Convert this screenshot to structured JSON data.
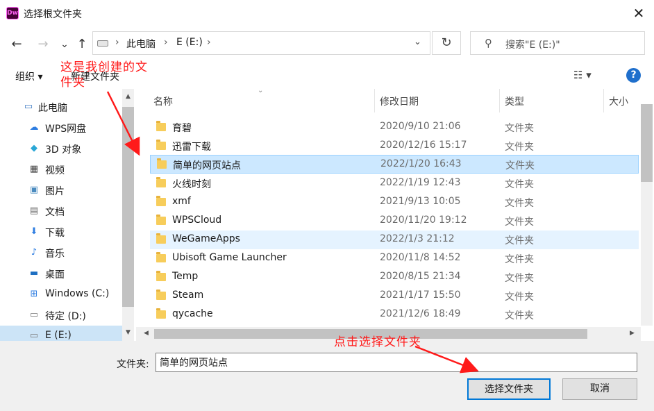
{
  "window": {
    "app_icon_text": "Dw",
    "title": "选择根文件夹",
    "close_glyph": "✕"
  },
  "nav": {
    "back_glyph": "←",
    "forward_glyph": "→",
    "recent_glyph": "⌄",
    "up_glyph": "↑",
    "breadcrumb": [
      "此电脑",
      "E (E:)"
    ],
    "separator": "›",
    "dropdown_glyph": "⌄",
    "refresh_glyph": "↻",
    "search_placeholder": "搜索\"E (E:)\""
  },
  "toolbar": {
    "organize_label": "组织 ▾",
    "new_folder_label": "新建文件夹",
    "view_glyph": "☷ ▾",
    "help_glyph": "?"
  },
  "sidebar": {
    "items": [
      {
        "label": "此电脑",
        "icon": "computer-icon"
      },
      {
        "label": "WPS网盘",
        "icon": "cloud-icon"
      },
      {
        "label": "3D 对象",
        "icon": "cube-icon"
      },
      {
        "label": "视频",
        "icon": "film-icon"
      },
      {
        "label": "图片",
        "icon": "picture-icon"
      },
      {
        "label": "文档",
        "icon": "document-icon"
      },
      {
        "label": "下载",
        "icon": "download-icon"
      },
      {
        "label": "音乐",
        "icon": "music-icon"
      },
      {
        "label": "桌面",
        "icon": "desktop-icon"
      },
      {
        "label": "Windows (C:)",
        "icon": "drive-c-icon"
      },
      {
        "label": "待定 (D:)",
        "icon": "drive-icon"
      },
      {
        "label": "E (E:)",
        "icon": "drive-icon"
      }
    ]
  },
  "filelist": {
    "columns": [
      "名称",
      "修改日期",
      "类型",
      "大小"
    ],
    "rows": [
      {
        "name": "育碧",
        "date": "2020/9/10 21:06",
        "type": "文件夹"
      },
      {
        "name": "迅雷下载",
        "date": "2020/12/16 15:17",
        "type": "文件夹"
      },
      {
        "name": "简单的网页站点",
        "date": "2022/1/20 16:43",
        "type": "文件夹"
      },
      {
        "name": "火线时刻",
        "date": "2022/1/19 12:43",
        "type": "文件夹"
      },
      {
        "name": "xmf",
        "date": "2021/9/13 10:05",
        "type": "文件夹"
      },
      {
        "name": "WPSCloud",
        "date": "2020/11/20 19:12",
        "type": "文件夹"
      },
      {
        "name": "WeGameApps",
        "date": "2022/1/3 21:12",
        "type": "文件夹"
      },
      {
        "name": "Ubisoft Game Launcher",
        "date": "2020/11/8 14:52",
        "type": "文件夹"
      },
      {
        "name": "Temp",
        "date": "2020/8/15 21:34",
        "type": "文件夹"
      },
      {
        "name": "Steam",
        "date": "2021/1/17 15:50",
        "type": "文件夹"
      },
      {
        "name": "qycache",
        "date": "2021/12/6 18:49",
        "type": "文件夹"
      }
    ],
    "selected_row": 2,
    "hover_row": 6
  },
  "bottom": {
    "folder_label": "文件夹:",
    "folder_value": "简单的网页站点",
    "select_button": "选择文件夹",
    "cancel_button": "取消"
  },
  "annotations": {
    "created_note_line1": "这是我创建的文",
    "created_note_line2": "件夹",
    "click_note": "点击选择文件夹",
    "color": "#ff1a1a"
  }
}
